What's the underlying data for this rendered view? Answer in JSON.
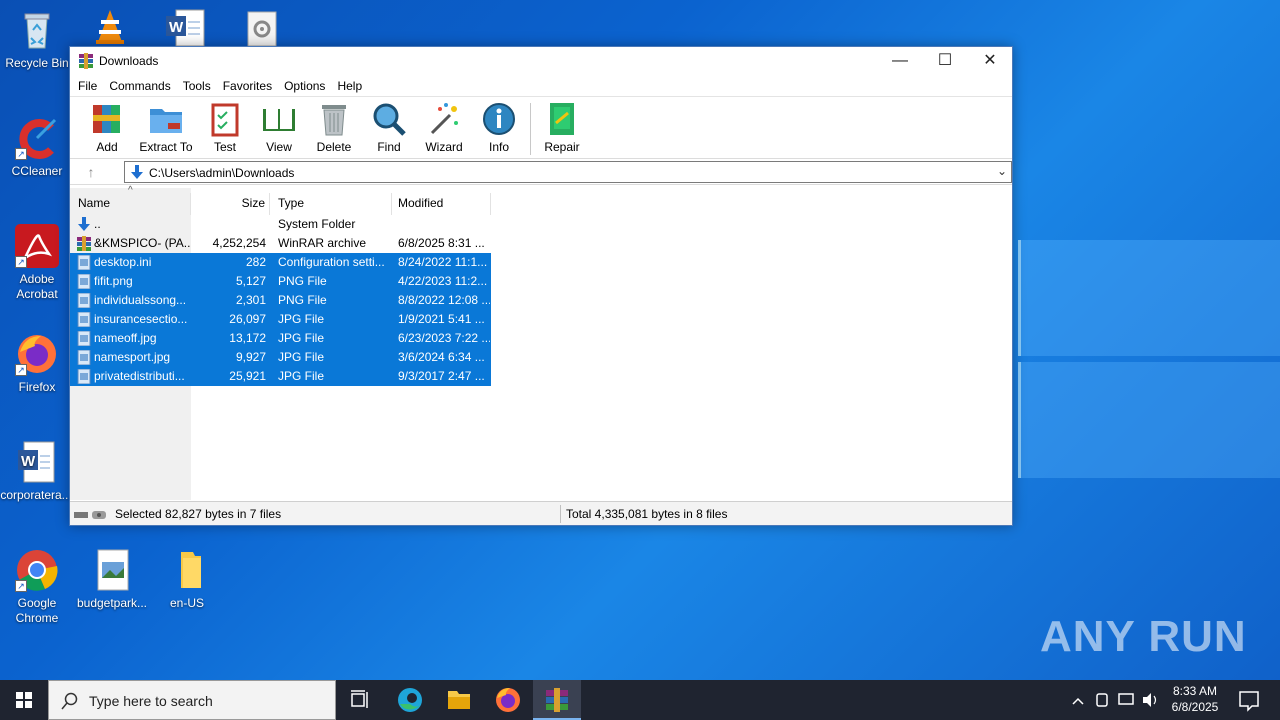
{
  "desktop": {
    "icons": [
      {
        "label": "Recycle Bin"
      },
      {
        "label": "CCleaner"
      },
      {
        "label": "Adobe Acrobat"
      },
      {
        "label": "Firefox"
      },
      {
        "label": "corporatera..."
      },
      {
        "label": "Google Chrome"
      },
      {
        "label": "budgetpark..."
      },
      {
        "label": "en-US"
      }
    ],
    "watermark": "ANY RUN"
  },
  "window": {
    "title": "Downloads",
    "controls": {
      "minimize": "—",
      "maximize": "☐",
      "close": "✕"
    },
    "menu": [
      "File",
      "Commands",
      "Tools",
      "Favorites",
      "Options",
      "Help"
    ],
    "toolbar": [
      {
        "label": "Add",
        "icon": "add-archive-icon"
      },
      {
        "label": "Extract To",
        "icon": "extract-folder-icon"
      },
      {
        "label": "Test",
        "icon": "test-clipboard-icon"
      },
      {
        "label": "View",
        "icon": "view-book-icon"
      },
      {
        "label": "Delete",
        "icon": "trash-icon"
      },
      {
        "label": "Find",
        "icon": "magnifier-icon"
      },
      {
        "label": "Wizard",
        "icon": "magic-wand-icon"
      },
      {
        "label": "Info",
        "icon": "info-icon"
      },
      {
        "label": "Repair",
        "icon": "repair-kit-icon"
      }
    ],
    "address": {
      "path": "C:\\Users\\admin\\Downloads"
    },
    "columns": {
      "name": "Name",
      "size": "Size",
      "type": "Type",
      "modified": "Modified"
    },
    "files": [
      {
        "name": "..",
        "size": "",
        "type": "System Folder",
        "modified": "",
        "selected": false,
        "icon": "parent-folder-icon"
      },
      {
        "name": "&KMSPICO- (PA...",
        "size": "4,252,254",
        "type": "WinRAR archive",
        "modified": "6/8/2025 8:31 ...",
        "selected": false,
        "icon": "rar-archive-icon"
      },
      {
        "name": "desktop.ini",
        "size": "282",
        "type": "Configuration setti...",
        "modified": "8/24/2022 11:1...",
        "selected": true,
        "icon": "file-icon"
      },
      {
        "name": "fifit.png",
        "size": "5,127",
        "type": "PNG File",
        "modified": "4/22/2023 11:2...",
        "selected": true,
        "icon": "file-icon"
      },
      {
        "name": "individualssong...",
        "size": "2,301",
        "type": "PNG File",
        "modified": "8/8/2022 12:08 ...",
        "selected": true,
        "icon": "file-icon"
      },
      {
        "name": "insurancesectio...",
        "size": "26,097",
        "type": "JPG File",
        "modified": "1/9/2021 5:41 ...",
        "selected": true,
        "icon": "file-icon"
      },
      {
        "name": "nameoff.jpg",
        "size": "13,172",
        "type": "JPG File",
        "modified": "6/23/2023 7:22 ...",
        "selected": true,
        "icon": "file-icon"
      },
      {
        "name": "namesport.jpg",
        "size": "9,927",
        "type": "JPG File",
        "modified": "3/6/2024 6:34 ...",
        "selected": true,
        "icon": "file-icon"
      },
      {
        "name": "privatedistributi...",
        "size": "25,921",
        "type": "JPG File",
        "modified": "9/3/2017 2:47 ...",
        "selected": true,
        "icon": "file-icon"
      }
    ],
    "status": {
      "selected": "Selected 82,827 bytes in 7 files",
      "total": "Total 4,335,081 bytes in 8 files"
    }
  },
  "taskbar": {
    "search_placeholder": "Type here to search",
    "apps": [
      "task-view-icon",
      "edge-icon",
      "file-explorer-icon",
      "firefox-icon",
      "winrar-icon"
    ],
    "clock": {
      "time": "8:33 AM",
      "date": "6/8/2025"
    }
  },
  "colors": {
    "selection": "#0a78d7",
    "desktop": "#0b63cf",
    "taskbar": "#1f2430"
  }
}
